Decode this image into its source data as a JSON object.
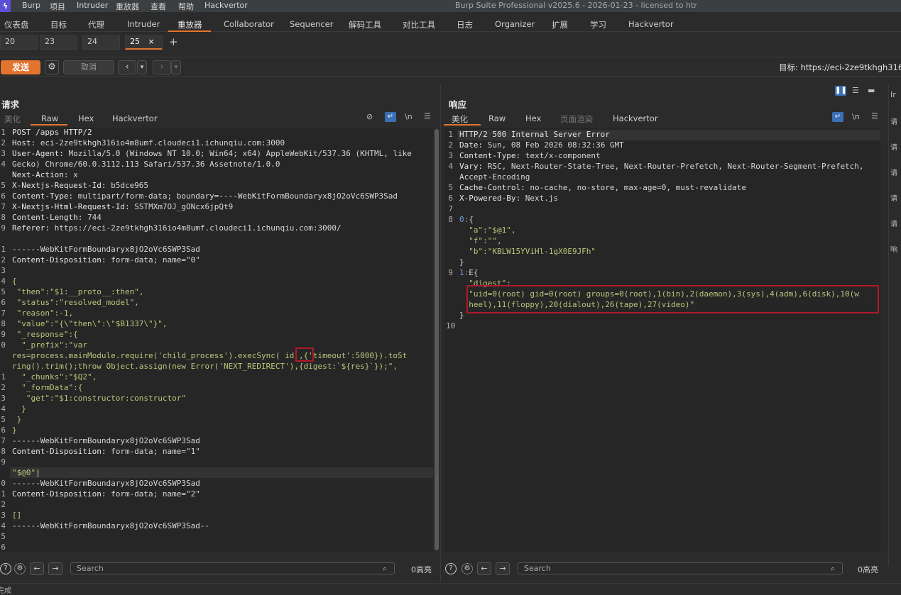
{
  "menubar": {
    "items": [
      "Burp",
      "项目",
      "Intruder",
      "重放器",
      "查看",
      "帮助",
      "Hackvertor"
    ],
    "title": "Burp Suite Professional v2025.6 - 2026-01-23 - licensed to htr"
  },
  "main_tabs": [
    "仪表盘",
    "目标",
    "代理",
    "Intruder",
    "重放器",
    "Collaborator",
    "Sequencer",
    "解码工具",
    "对比工具",
    "日志",
    "Organizer",
    "扩展",
    "学习",
    "Hackvertor"
  ],
  "main_tab_active": "重放器",
  "sub_tabs": [
    "20",
    "23",
    "24",
    "25"
  ],
  "sub_tab_active": "25",
  "sub_tab_close": "×",
  "sub_tab_add": "+",
  "toolbar": {
    "send_label": "发送",
    "cancel_label": "取消",
    "target": "目标: https://eci-2ze9tkhgh316io4"
  },
  "request": {
    "title": "请求",
    "tabs": [
      "美化",
      "Raw",
      "Hex",
      "Hackvertor"
    ],
    "active_tab": "Raw",
    "line_numbers": [
      "1",
      "2",
      "3",
      "4",
      "",
      "5",
      "6",
      "7",
      "8",
      "9",
      "",
      "1",
      "2",
      "3",
      "4",
      "5",
      "6",
      "7",
      "8",
      "9",
      "0",
      "",
      "",
      "1",
      "2",
      "3",
      "4",
      "5",
      "6",
      "7",
      "8",
      "9",
      "",
      "0",
      "1",
      "2",
      "3",
      "4",
      "5",
      "6",
      "7"
    ],
    "search_placeholder": "Search",
    "hits": "0高亮"
  },
  "response": {
    "title": "响应",
    "tabs": [
      "美化",
      "Raw",
      "Hex",
      "页面渲染",
      "Hackvertor"
    ],
    "active_tab": "美化",
    "line_numbers": [
      "1",
      "2",
      "3",
      "4",
      "",
      "5",
      "6",
      "7",
      "8",
      "",
      "",
      "",
      "",
      "9",
      "",
      "",
      "",
      "",
      "10"
    ],
    "search_placeholder": "Search",
    "hits": "0高亮"
  },
  "right_strip": [
    "Ir",
    "请",
    "请",
    "请",
    "请",
    "请",
    "响"
  ],
  "status_text": "完成",
  "colors": {
    "accent": "#e2742f",
    "highlight_box": "#b0182a",
    "string": "#b9c77a",
    "operator": "#6f9fd8"
  }
}
